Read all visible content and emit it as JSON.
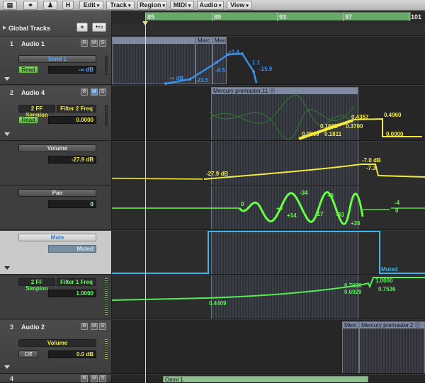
{
  "toolbar": {
    "key_shortcut": "H",
    "menus": [
      "Edit",
      "Track",
      "Region",
      "MIDI",
      "Audio",
      "View"
    ]
  },
  "ruler": {
    "bars": [
      "85",
      "89",
      "93",
      "97",
      "101"
    ]
  },
  "global_tracks": {
    "label": "Global Tracks"
  },
  "tracks": [
    {
      "number": "1",
      "name": "Audio 1",
      "param": "Send 1",
      "mode": "Read",
      "value": "-∞ dB"
    },
    {
      "number": "2",
      "name": "Audio 4",
      "param_plugin": "2 FF Simplon",
      "param_name": "Filter 2 Freq",
      "mode": "Read",
      "value": "0.0000"
    },
    {
      "param": "Volume",
      "value": "-27.9 dB"
    },
    {
      "param": "Pan",
      "value": "0"
    },
    {
      "param": "Mute",
      "value": "Muted"
    },
    {
      "param_plugin": "2 FF Simplon",
      "param_name": "Filter 1 Freq",
      "value": "1.0000"
    },
    {
      "number": "3",
      "name": "Audio 2",
      "param": "Volume",
      "mode": "Off",
      "value": "0.0 dB"
    },
    {
      "number": "4",
      "name": "Omni 1"
    }
  ],
  "regions": {
    "r1a": "",
    "r1b": "Merc",
    "r1c": "Merc",
    "r2": "Mercury premaster.11 ⓞ",
    "r3a": "Merc",
    "r3b": "Mercury premaster.2 ⓞ",
    "r4": "Omni 1"
  },
  "automation_labels": {
    "send": [
      "-∞ dB",
      "-21.5",
      "-8.5",
      "+0.4",
      "1.1",
      "-15.9"
    ],
    "filter2": [
      "0.1663",
      "0.4357",
      "0.4960",
      "0.0000",
      "0.1811",
      "0.3700",
      "0.0000"
    ],
    "volume": [
      "-27.9 dB",
      "-7.0 dB",
      "-7.3"
    ],
    "pan": [
      "0",
      "+9",
      "+14",
      "-34",
      "-17",
      "+3",
      "-33",
      "+36",
      "-4",
      "0"
    ],
    "mute": [
      "Muted"
    ],
    "filter1": [
      "0.4409",
      "0.7036",
      "0.6929",
      "1.0000",
      "0.7536"
    ]
  },
  "colors": {
    "send": "#3b8fe8",
    "filter": "#f2ea3a",
    "volume": "#f2ea3a",
    "pan": "#66ff44",
    "mute": "#36b7f0",
    "filter1": "#55ee55"
  }
}
